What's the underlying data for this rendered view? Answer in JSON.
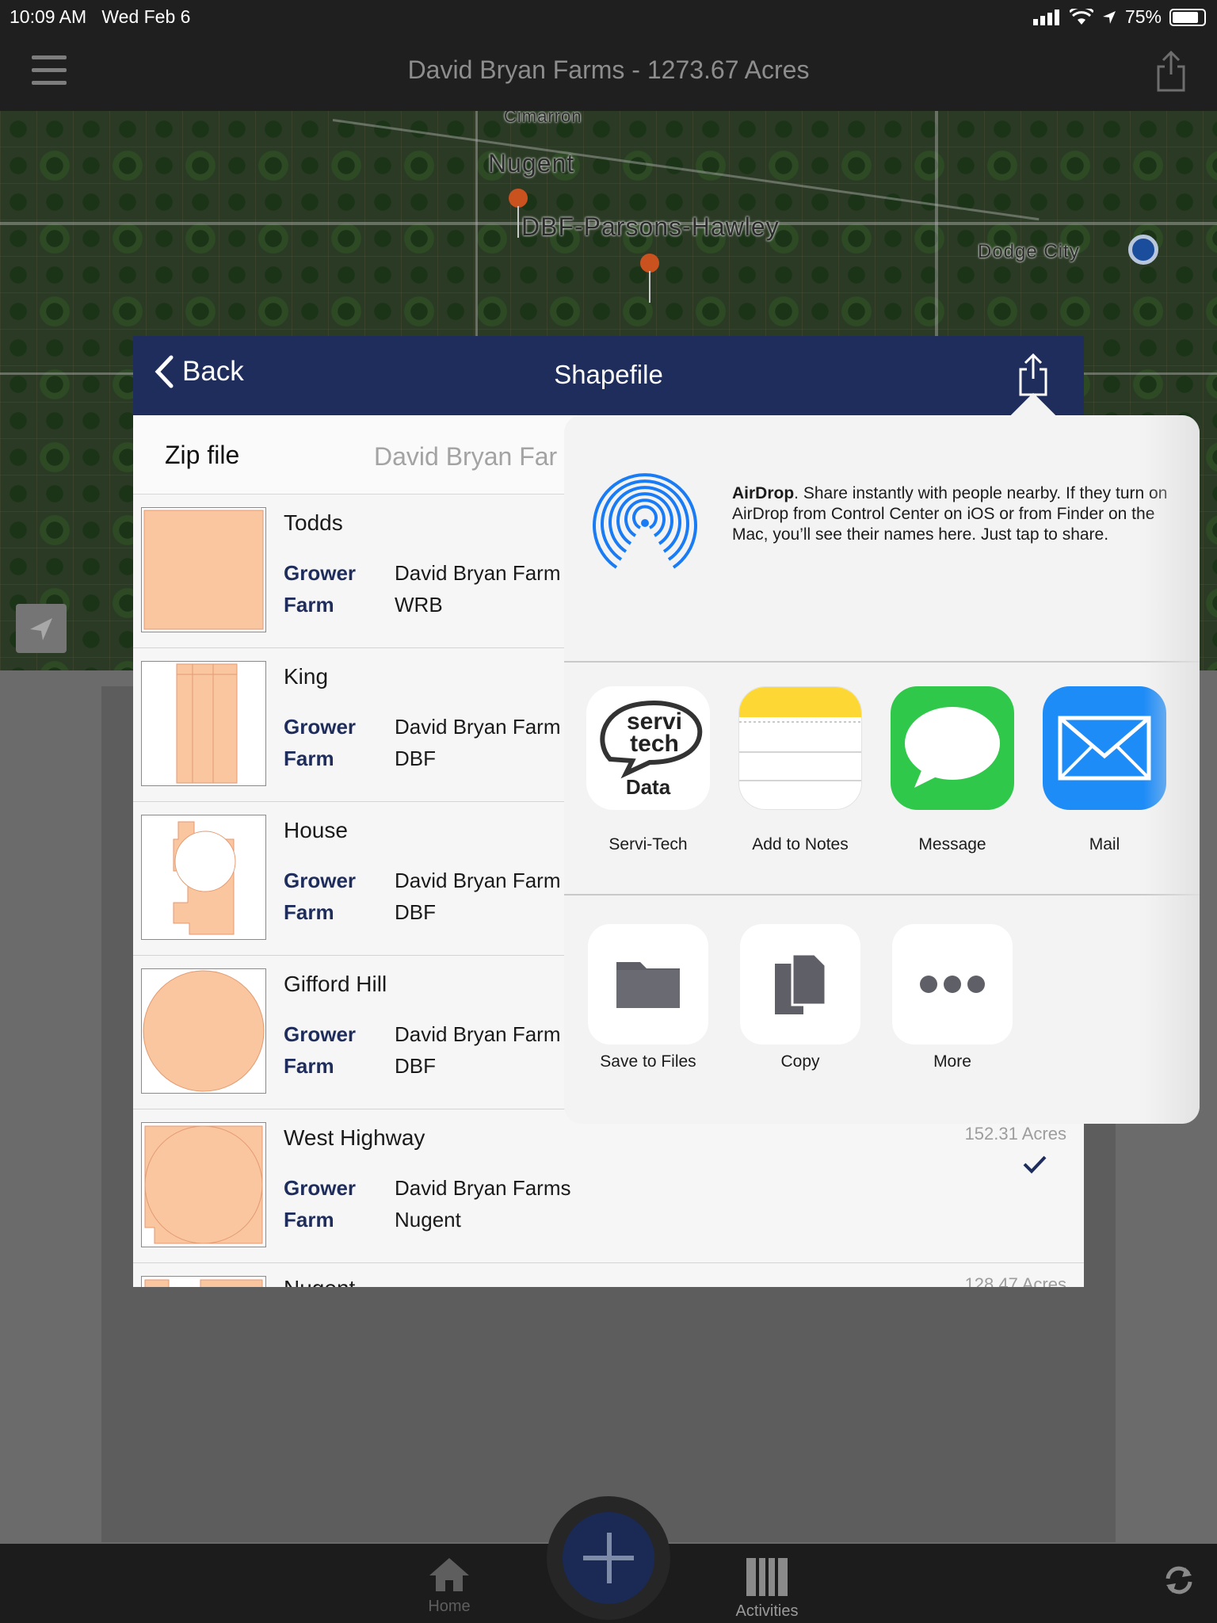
{
  "status": {
    "time": "10:09 AM",
    "date": "Wed Feb 6",
    "battery": "75%"
  },
  "nav": {
    "title": "David Bryan Farms - 1273.67 Acres"
  },
  "map": {
    "labels": {
      "cimarron": "Cimarron",
      "nugent": "Nugent",
      "parsons": "DBF-Parsons-Hawley",
      "dodge": "Dodge City"
    }
  },
  "sheet": {
    "back_label": "Back",
    "title": "Shapefile",
    "zip_label": "Zip file",
    "zip_value": "David Bryan Far",
    "grower_key": "Grower",
    "farm_key": "Farm",
    "fields": [
      {
        "name": "Todds",
        "grower": "David Bryan Farm",
        "farm": "WRB"
      },
      {
        "name": "King",
        "grower": "David Bryan Farm",
        "farm": "DBF"
      },
      {
        "name": "House",
        "grower": "David Bryan Farm",
        "farm": "DBF"
      },
      {
        "name": "Gifford Hill",
        "grower": "David Bryan Farm",
        "farm": "DBF"
      },
      {
        "name": "West Highway",
        "grower": "David Bryan Farms",
        "farm": "Nugent",
        "acres": "152.31 Acres",
        "selected": true
      },
      {
        "name": "Nugent",
        "acres": "128.47 Acres"
      }
    ]
  },
  "share": {
    "airdrop_title": "AirDrop",
    "airdrop_desc": ". Share instantly with people nearby. If they turn on AirDrop from Control Center on iOS or from Finder on the Mac, you’ll see their names here. Just tap to share.",
    "apps": [
      {
        "label": "Servi-Tech",
        "icon": "servi-tech-icon"
      },
      {
        "label": "Add to Notes",
        "icon": "notes-icon"
      },
      {
        "label": "Message",
        "icon": "message-icon"
      },
      {
        "label": "Mail",
        "icon": "mail-icon"
      }
    ],
    "servitech_logo": {
      "line1": "servi",
      "line2": "tech",
      "line3": "Data"
    },
    "actions": [
      {
        "label": "Save to Files",
        "icon": "folder-icon"
      },
      {
        "label": "Copy",
        "icon": "copy-icon"
      },
      {
        "label": "More",
        "icon": "more-icon"
      }
    ]
  },
  "tabbar": {
    "home": "Home",
    "activities": "Activities"
  },
  "colors": {
    "navy": "#1f2d5c",
    "field_fill": "#f9c6a0",
    "messages_green": "#2fc84a",
    "mail_blue": "#1e8cf7"
  }
}
